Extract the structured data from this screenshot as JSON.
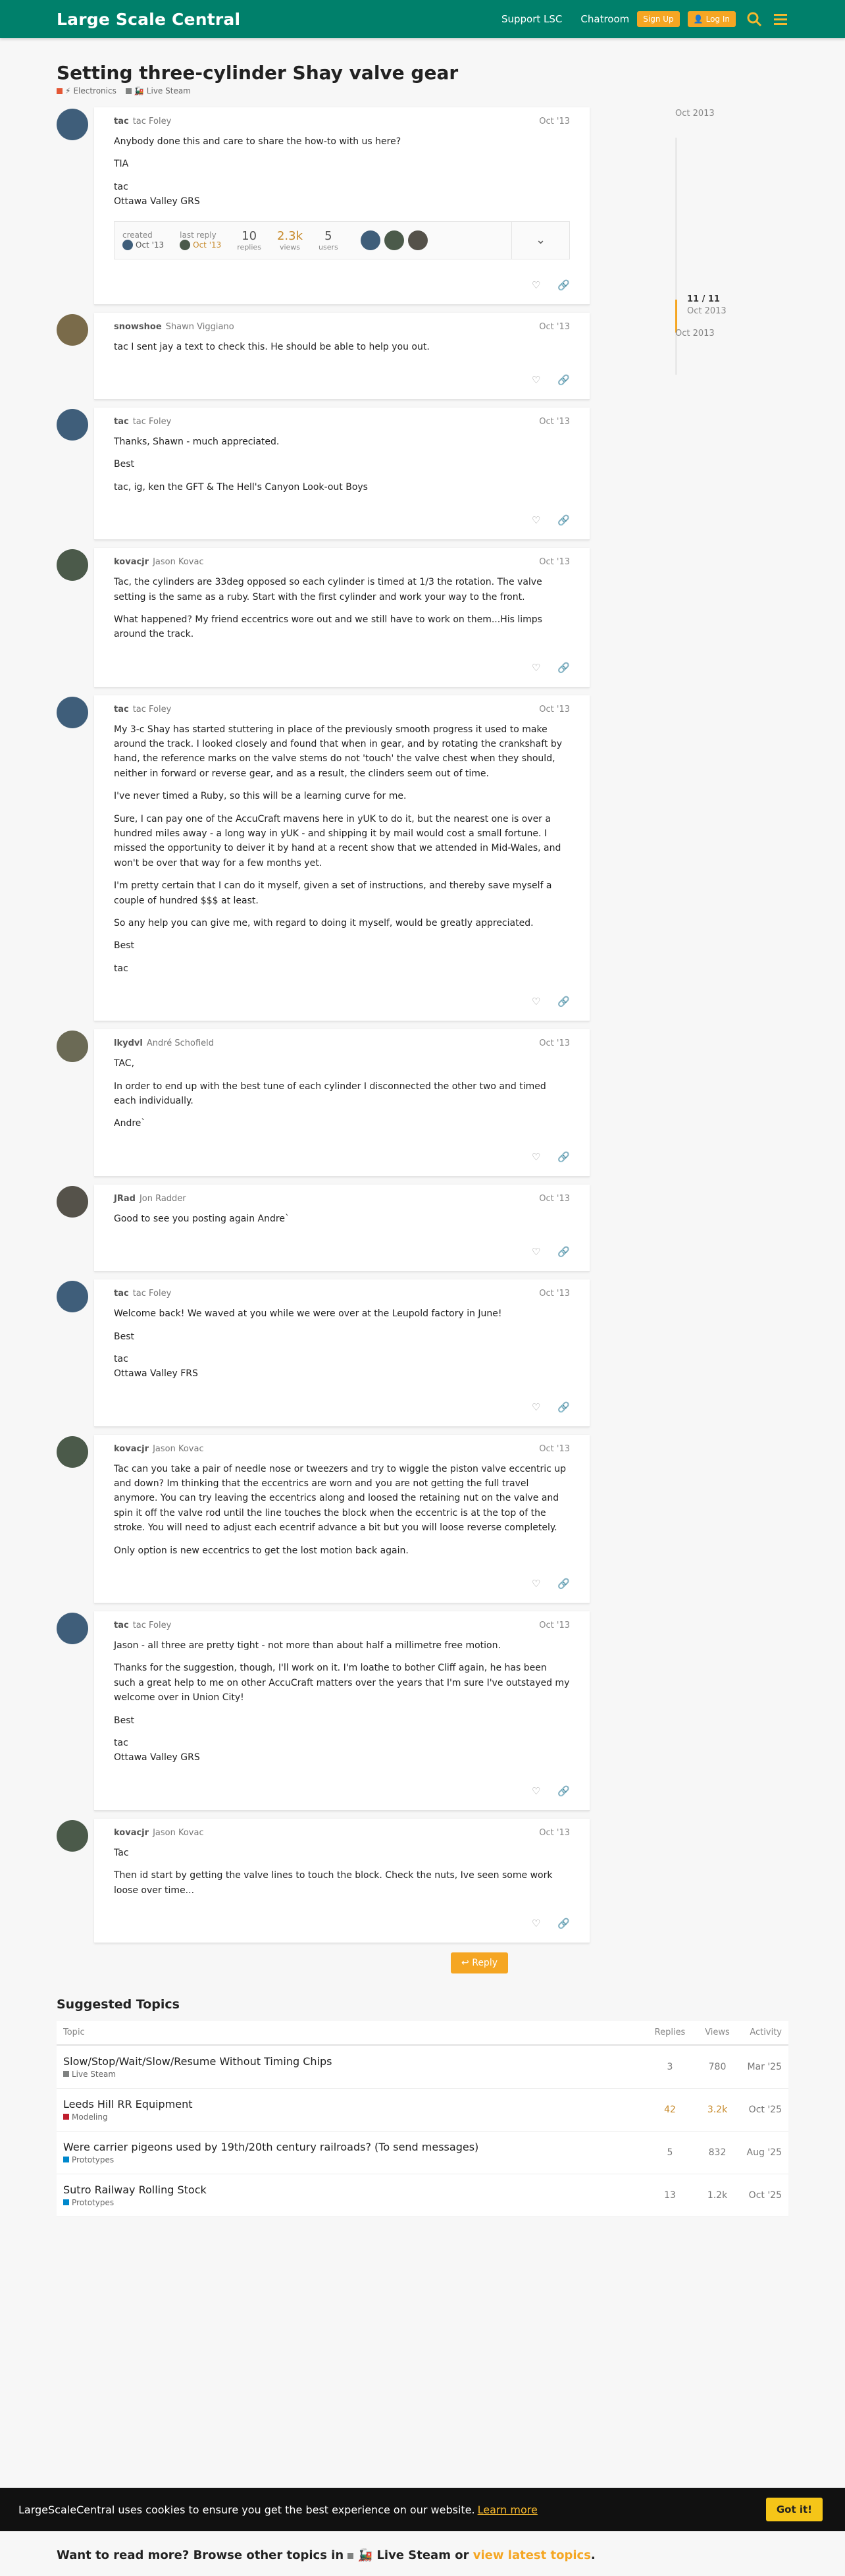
{
  "header": {
    "logo": "Large Scale Central",
    "support": "Support LSC",
    "chatroom": "Chatroom",
    "signup": "Sign Up",
    "login": "Log In"
  },
  "topic": {
    "title": "Setting three-cylinder Shay valve gear",
    "crumbs": [
      {
        "label": "Electronics",
        "color": "#e45735"
      },
      {
        "label": "Live Steam",
        "color": "#808281"
      }
    ]
  },
  "topic_map": {
    "created_label": "created",
    "created_date": "Oct '13",
    "last_label": "last reply",
    "last_date": "Oct '13",
    "replies": "10",
    "replies_label": "replies",
    "views": "2.3k",
    "views_label": "views",
    "users": "5",
    "users_label": "users"
  },
  "timeline": {
    "top_date": "Oct 2013",
    "position": "11 / 11",
    "position_date": "Oct 2013",
    "bottom_date": "Oct 2013"
  },
  "posts": [
    {
      "user": "tac",
      "full": "tac Foley",
      "date": "Oct '13",
      "avatar_color": "#3f5e7a",
      "paras": [
        "Anybody done this and care to share the how-to with us here?",
        "TIA",
        "tac\nOttawa Valley GRS"
      ]
    },
    {
      "user": "snowshoe",
      "full": "Shawn Viggiano",
      "date": "Oct '13",
      "avatar_color": "#7a6b4a",
      "paras": [
        "tac I sent jay a text to check this. He should be able to help you out."
      ]
    },
    {
      "user": "tac",
      "full": "tac Foley",
      "date": "Oct '13",
      "avatar_color": "#3f5e7a",
      "paras": [
        "Thanks, Shawn - much appreciated.",
        "Best",
        "tac, ig, ken the GFT & The Hell's Canyon Look-out Boys"
      ]
    },
    {
      "user": "kovacjr",
      "full": "Jason Kovac",
      "date": "Oct '13",
      "avatar_color": "#4b5a4a",
      "paras": [
        "Tac, the cylinders are 33deg opposed so each cylinder is timed at 1/3 the rotation. The valve setting is the same as a ruby. Start with the first cylinder and work your way to the front.",
        "What happened? My friend eccentrics wore out and we still have to work on them...His limps around the track."
      ]
    },
    {
      "user": "tac",
      "full": "tac Foley",
      "date": "Oct '13",
      "avatar_color": "#3f5e7a",
      "paras": [
        "My 3-c Shay has started stuttering in place of the previously smooth progress it used to make around the track. I looked closely and found that when in gear, and by rotating the crankshaft by hand, the reference marks on the valve stems do not 'touch' the valve chest when they should, neither in forward or reverse gear, and as a result, the clinders seem out of time.",
        "I've never timed a Ruby, so this will be a learning curve for me.",
        "Sure, I can pay one of the AccuCraft mavens here in yUK to do it, but the nearest one is over a hundred miles away - a long way in yUK - and shipping it by mail would cost a small fortune. I missed the opportunity to deiver it by hand at a recent show that we attended in Mid-Wales, and won't be over that way for a few months yet.",
        "I'm pretty certain that I can do it myself, given a set of instructions, and thereby save myself a couple of hundred $$$ at least.",
        "So any help you can give me, with regard to doing it myself, would be greatly appreciated.",
        "Best",
        "tac"
      ]
    },
    {
      "user": "lkydvl",
      "full": "André Schofield",
      "date": "Oct '13",
      "avatar_color": "#6b6a55",
      "paras": [
        "TAC,",
        "In order to end up with the best tune of each cylinder I disconnected the other two and timed each individually.",
        "Andre`"
      ]
    },
    {
      "user": "JRad",
      "full": "Jon Radder",
      "date": "Oct '13",
      "avatar_color": "#55524a",
      "paras": [
        "Good to see you posting again Andre`"
      ]
    },
    {
      "user": "tac",
      "full": "tac Foley",
      "date": "Oct '13",
      "avatar_color": "#3f5e7a",
      "paras": [
        "Welcome back! We waved at you while we were over at the Leupold factory in June!",
        "Best",
        "tac\nOttawa Valley FRS"
      ]
    },
    {
      "user": "kovacjr",
      "full": "Jason Kovac",
      "date": "Oct '13",
      "avatar_color": "#4b5a4a",
      "paras": [
        "Tac can you take a pair of needle nose or tweezers and try to wiggle the piston valve eccentric up and down? Im thinking that the eccentrics are worn and you are not getting the full travel anymore. You can try leaving the eccentrics along and loosed the retaining nut on the valve and spin it off the valve rod until the line touches the block when the eccentric is at the top of the stroke. You will need to adjust each ecentrif advance a bit but you will loose reverse completely.",
        "Only option is new eccentrics to get the lost motion back again."
      ]
    },
    {
      "user": "tac",
      "full": "tac Foley",
      "date": "Oct '13",
      "avatar_color": "#3f5e7a",
      "paras": [
        "Jason - all three are pretty tight - not more than about half a millimetre free motion.",
        "Thanks for the suggestion, though, I'll work on it. I'm loathe to bother Cliff again, he has been such a great help to me on other AccuCraft matters over the years that I'm sure I've outstayed my welcome over in Union City!",
        "Best",
        "tac\nOttawa Valley GRS"
      ]
    },
    {
      "user": "kovacjr",
      "full": "Jason Kovac",
      "date": "Oct '13",
      "avatar_color": "#4b5a4a",
      "paras": [
        "Tac",
        "Then id start by getting the valve lines to touch the block. Check the nuts, Ive seen some work loose over time..."
      ]
    }
  ],
  "reply_label": "Reply",
  "suggested": {
    "title": "Suggested Topics",
    "cols": {
      "topic": "Topic",
      "replies": "Replies",
      "views": "Views",
      "activity": "Activity"
    },
    "rows": [
      {
        "title": "Slow/Stop/Wait/Slow/Resume Without Timing Chips",
        "cat": "Live Steam",
        "cat_color": "#808281",
        "replies": "3",
        "views": "780",
        "activity": "Mar '25",
        "hot": false
      },
      {
        "title": "Leeds Hill RR Equipment",
        "cat": "Modeling",
        "cat_color": "#bf1e2e",
        "replies": "42",
        "views": "3.2k",
        "activity": "Oct '25",
        "hot": true
      },
      {
        "title": "Were carrier pigeons used by 19th/20th century railroads? (To send messages)",
        "cat": "Prototypes",
        "cat_color": "#0088cc",
        "replies": "5",
        "views": "832",
        "activity": "Aug '25",
        "hot": false
      },
      {
        "title": "Sutro Railway Rolling Stock",
        "cat": "Prototypes",
        "cat_color": "#0088cc",
        "replies": "13",
        "views": "1.2k",
        "activity": "Oct '25",
        "hot": false
      }
    ]
  },
  "cookie": {
    "text": "LargeScaleCentral uses cookies to ensure you get the best experience on our website.",
    "link": "Learn more",
    "button": "Got it!"
  },
  "more": {
    "prefix": "Want to read more? Browse other topics in",
    "cat": "Live Steam",
    "or": "or",
    "latest": "view latest topics",
    "suffix": "."
  },
  "colors": {
    "header": "#00806b",
    "accent": "#f5a623"
  }
}
